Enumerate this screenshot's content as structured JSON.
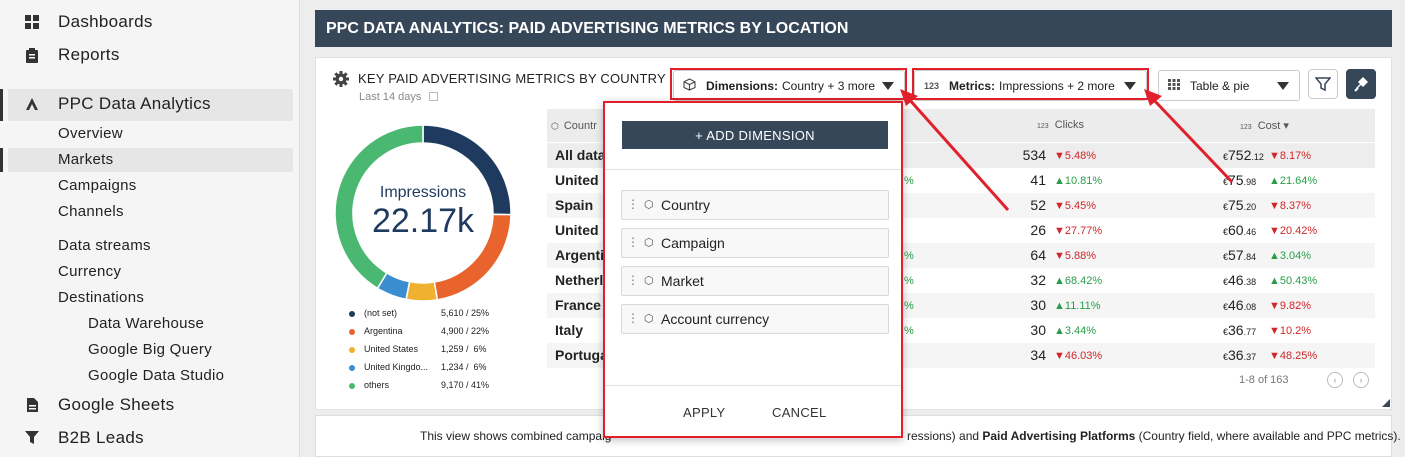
{
  "sidebar": {
    "items": [
      {
        "label": "Dashboards",
        "icon": "grid-icon"
      },
      {
        "label": "Reports",
        "icon": "clipboard-icon"
      },
      {
        "label": "PPC Data Analytics",
        "icon": "analytics-icon"
      },
      {
        "label": "Google Sheets",
        "icon": "sheet-icon"
      },
      {
        "label": "B2B Leads",
        "icon": "funnel-icon"
      }
    ],
    "sub_items": [
      "Overview",
      "Markets",
      "Campaigns",
      "Channels",
      "Data streams",
      "Currency",
      "Destinations"
    ],
    "destinations": [
      "Data Warehouse",
      "Google Big Query",
      "Google Data Studio"
    ],
    "active_item": "PPC Data Analytics",
    "active_sub": "Markets"
  },
  "header": {
    "title": "PPC DATA ANALYTICS: PAID ADVERTISING METRICS BY LOCATION"
  },
  "card": {
    "title": "KEY PAID ADVERTISING METRICS BY COUNTRY",
    "subtitle": "Last 14 days",
    "dimensions": {
      "label": "Dimensions:",
      "value": "Country + 3 more"
    },
    "metrics": {
      "prefix": "123",
      "label": "Metrics:",
      "value": "Impressions + 2 more"
    },
    "view": {
      "value": "Table & pie"
    }
  },
  "donut": {
    "metric": "Impressions",
    "value": "22.17k",
    "legend": [
      {
        "name": "(not set)",
        "value": "5,610",
        "pct": "/ 25%"
      },
      {
        "name": "Argentina",
        "value": "4,900",
        "pct": "/ 22%"
      },
      {
        "name": "United States",
        "value": "1,259",
        "pct": "/  6%"
      },
      {
        "name": "United Kingdo...",
        "value": "1,234",
        "pct": "/  6%"
      },
      {
        "name": "others",
        "value": "9,170",
        "pct": "/ 41%"
      }
    ]
  },
  "chart_data": {
    "type": "pie",
    "title": "Impressions",
    "categories": [
      "(not set)",
      "Argentina",
      "United States",
      "United Kingdo...",
      "others"
    ],
    "values": [
      5610,
      4900,
      1259,
      1234,
      9170
    ],
    "colors": [
      "#1f3a5f",
      "#e8642c",
      "#f0b030",
      "#3a8ed0",
      "#4ab870"
    ]
  },
  "colors": {
    "header": "#37475a",
    "accent_red": "#e0202b",
    "up": "#2a9d4a",
    "down": "#d0262a"
  },
  "table": {
    "headers": {
      "country": "Countr",
      "clicks_prefix": "123",
      "clicks": "Clicks",
      "cost_prefix": "123",
      "cost": "Cost ▾"
    },
    "rows": [
      {
        "country": "All data",
        "mid": "",
        "clicks": "534",
        "clicks_delta": "▼5.48%",
        "clicks_dir": "dn",
        "cost_sym": "€",
        "cost": "752",
        "cost_dec": ".12",
        "cost_delta": "▼8.17%",
        "cost_dir": "dn"
      },
      {
        "country": "United",
        "mid": "%",
        "clicks": "41",
        "clicks_delta": "▲10.81%",
        "clicks_dir": "up",
        "cost_sym": "€",
        "cost": "75",
        "cost_dec": ".98",
        "cost_delta": "▲21.64%",
        "cost_dir": "up"
      },
      {
        "country": "Spain",
        "mid": "",
        "clicks": "52",
        "clicks_delta": "▼5.45%",
        "clicks_dir": "dn",
        "cost_sym": "€",
        "cost": "75",
        "cost_dec": ".20",
        "cost_delta": "▼8.37%",
        "cost_dir": "dn"
      },
      {
        "country": "United",
        "mid": "",
        "clicks": "26",
        "clicks_delta": "▼27.77%",
        "clicks_dir": "dn",
        "cost_sym": "€",
        "cost": "60",
        "cost_dec": ".46",
        "cost_delta": "▼20.42%",
        "cost_dir": "dn"
      },
      {
        "country": "Argentin",
        "mid": "%",
        "clicks": "64",
        "clicks_delta": "▼5.88%",
        "clicks_dir": "dn",
        "cost_sym": "€",
        "cost": "57",
        "cost_dec": ".84",
        "cost_delta": "▲3.04%",
        "cost_dir": "up"
      },
      {
        "country": "Netherl",
        "mid": "%",
        "clicks": "32",
        "clicks_delta": "▲68.42%",
        "clicks_dir": "up",
        "cost_sym": "€",
        "cost": "46",
        "cost_dec": ".38",
        "cost_delta": "▲50.43%",
        "cost_dir": "up"
      },
      {
        "country": "France",
        "mid": "%",
        "clicks": "30",
        "clicks_delta": "▲11.11%",
        "clicks_dir": "up",
        "cost_sym": "€",
        "cost": "46",
        "cost_dec": ".08",
        "cost_delta": "▼9.82%",
        "cost_dir": "dn"
      },
      {
        "country": "Italy",
        "mid": "%",
        "clicks": "30",
        "clicks_delta": "▲3.44%",
        "clicks_dir": "up",
        "cost_sym": "€",
        "cost": "36",
        "cost_dec": ".77",
        "cost_delta": "▼10.2%",
        "cost_dir": "dn"
      },
      {
        "country": "Portuga",
        "mid": "",
        "clicks": "34",
        "clicks_delta": "▼46.03%",
        "clicks_dir": "dn",
        "cost_sym": "€",
        "cost": "36",
        "cost_dec": ".37",
        "cost_delta": "▼48.25%",
        "cost_dir": "dn"
      }
    ],
    "pager": "1-8 of 163"
  },
  "popup": {
    "add_label": "+ ADD DIMENSION",
    "dimensions": [
      "Country",
      "Campaign",
      "Market",
      "Account currency"
    ],
    "apply": "APPLY",
    "cancel": "CANCEL"
  },
  "footer": {
    "left": "This view shows combined campaig",
    "right_pre": "ressions) and ",
    "right_bold": "Paid Advertising Platforms",
    "right_post": " (Country field, where available and PPC metrics)."
  }
}
